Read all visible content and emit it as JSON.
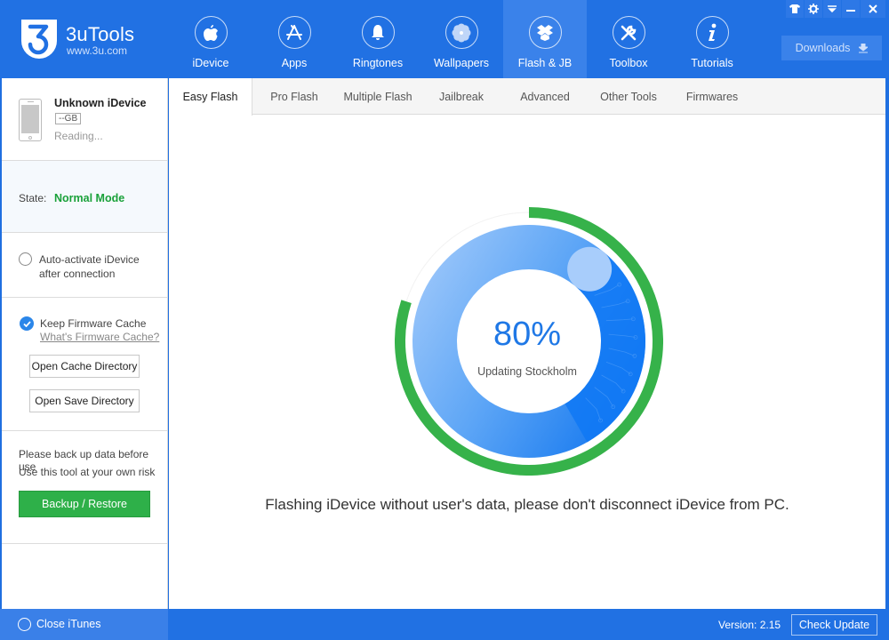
{
  "app": {
    "name": "3uTools",
    "url": "www.3u.com"
  },
  "nav": {
    "items": [
      {
        "label": "iDevice",
        "icon": "apple-icon"
      },
      {
        "label": "Apps",
        "icon": "app-store-icon"
      },
      {
        "label": "Ringtones",
        "icon": "bell-icon"
      },
      {
        "label": "Wallpapers",
        "icon": "flower-icon"
      },
      {
        "label": "Flash & JB",
        "icon": "box-icon",
        "active": true
      },
      {
        "label": "Toolbox",
        "icon": "tools-icon"
      },
      {
        "label": "Tutorials",
        "icon": "info-icon"
      }
    ]
  },
  "window_controls": [
    "skin-icon",
    "settings-icon",
    "menu-icon",
    "minimize-icon",
    "close-icon"
  ],
  "downloads": {
    "label": "Downloads",
    "icon": "download-icon"
  },
  "sidebar": {
    "device": {
      "name": "Unknown iDevice",
      "capacity": "--GB",
      "status": "Reading..."
    },
    "state": {
      "label": "State:",
      "value": "Normal Mode",
      "color": "#1aa13a"
    },
    "auto_activate": {
      "line1": "Auto-activate iDevice",
      "line2": "after connection",
      "checked": false
    },
    "firmware_cache": {
      "label": "Keep Firmware Cache",
      "checked": true,
      "link": "What's Firmware Cache?",
      "open_cache_button": "Open Cache Directory",
      "open_save_button": "Open Save Directory"
    },
    "backup": {
      "warning1": "Please back up data before use",
      "warning2": "Use this tool at your own risk",
      "button": "Backup / Restore"
    }
  },
  "tabs": [
    {
      "label": "Easy Flash",
      "active": true
    },
    {
      "label": "Pro Flash"
    },
    {
      "label": "Multiple Flash"
    },
    {
      "label": "Jailbreak"
    },
    {
      "label": "Advanced"
    },
    {
      "label": "Other Tools"
    },
    {
      "label": "Firmwares"
    }
  ],
  "progress": {
    "percent_text": "80%",
    "value": 0.8,
    "status": "Updating Stockholm",
    "ring_color": "#36b24a"
  },
  "message": "Flashing iDevice without user's data, please don't disconnect iDevice from PC.",
  "footer": {
    "close_itunes": "Close iTunes",
    "version": "Version: 2.15",
    "check_update": "Check Update"
  }
}
